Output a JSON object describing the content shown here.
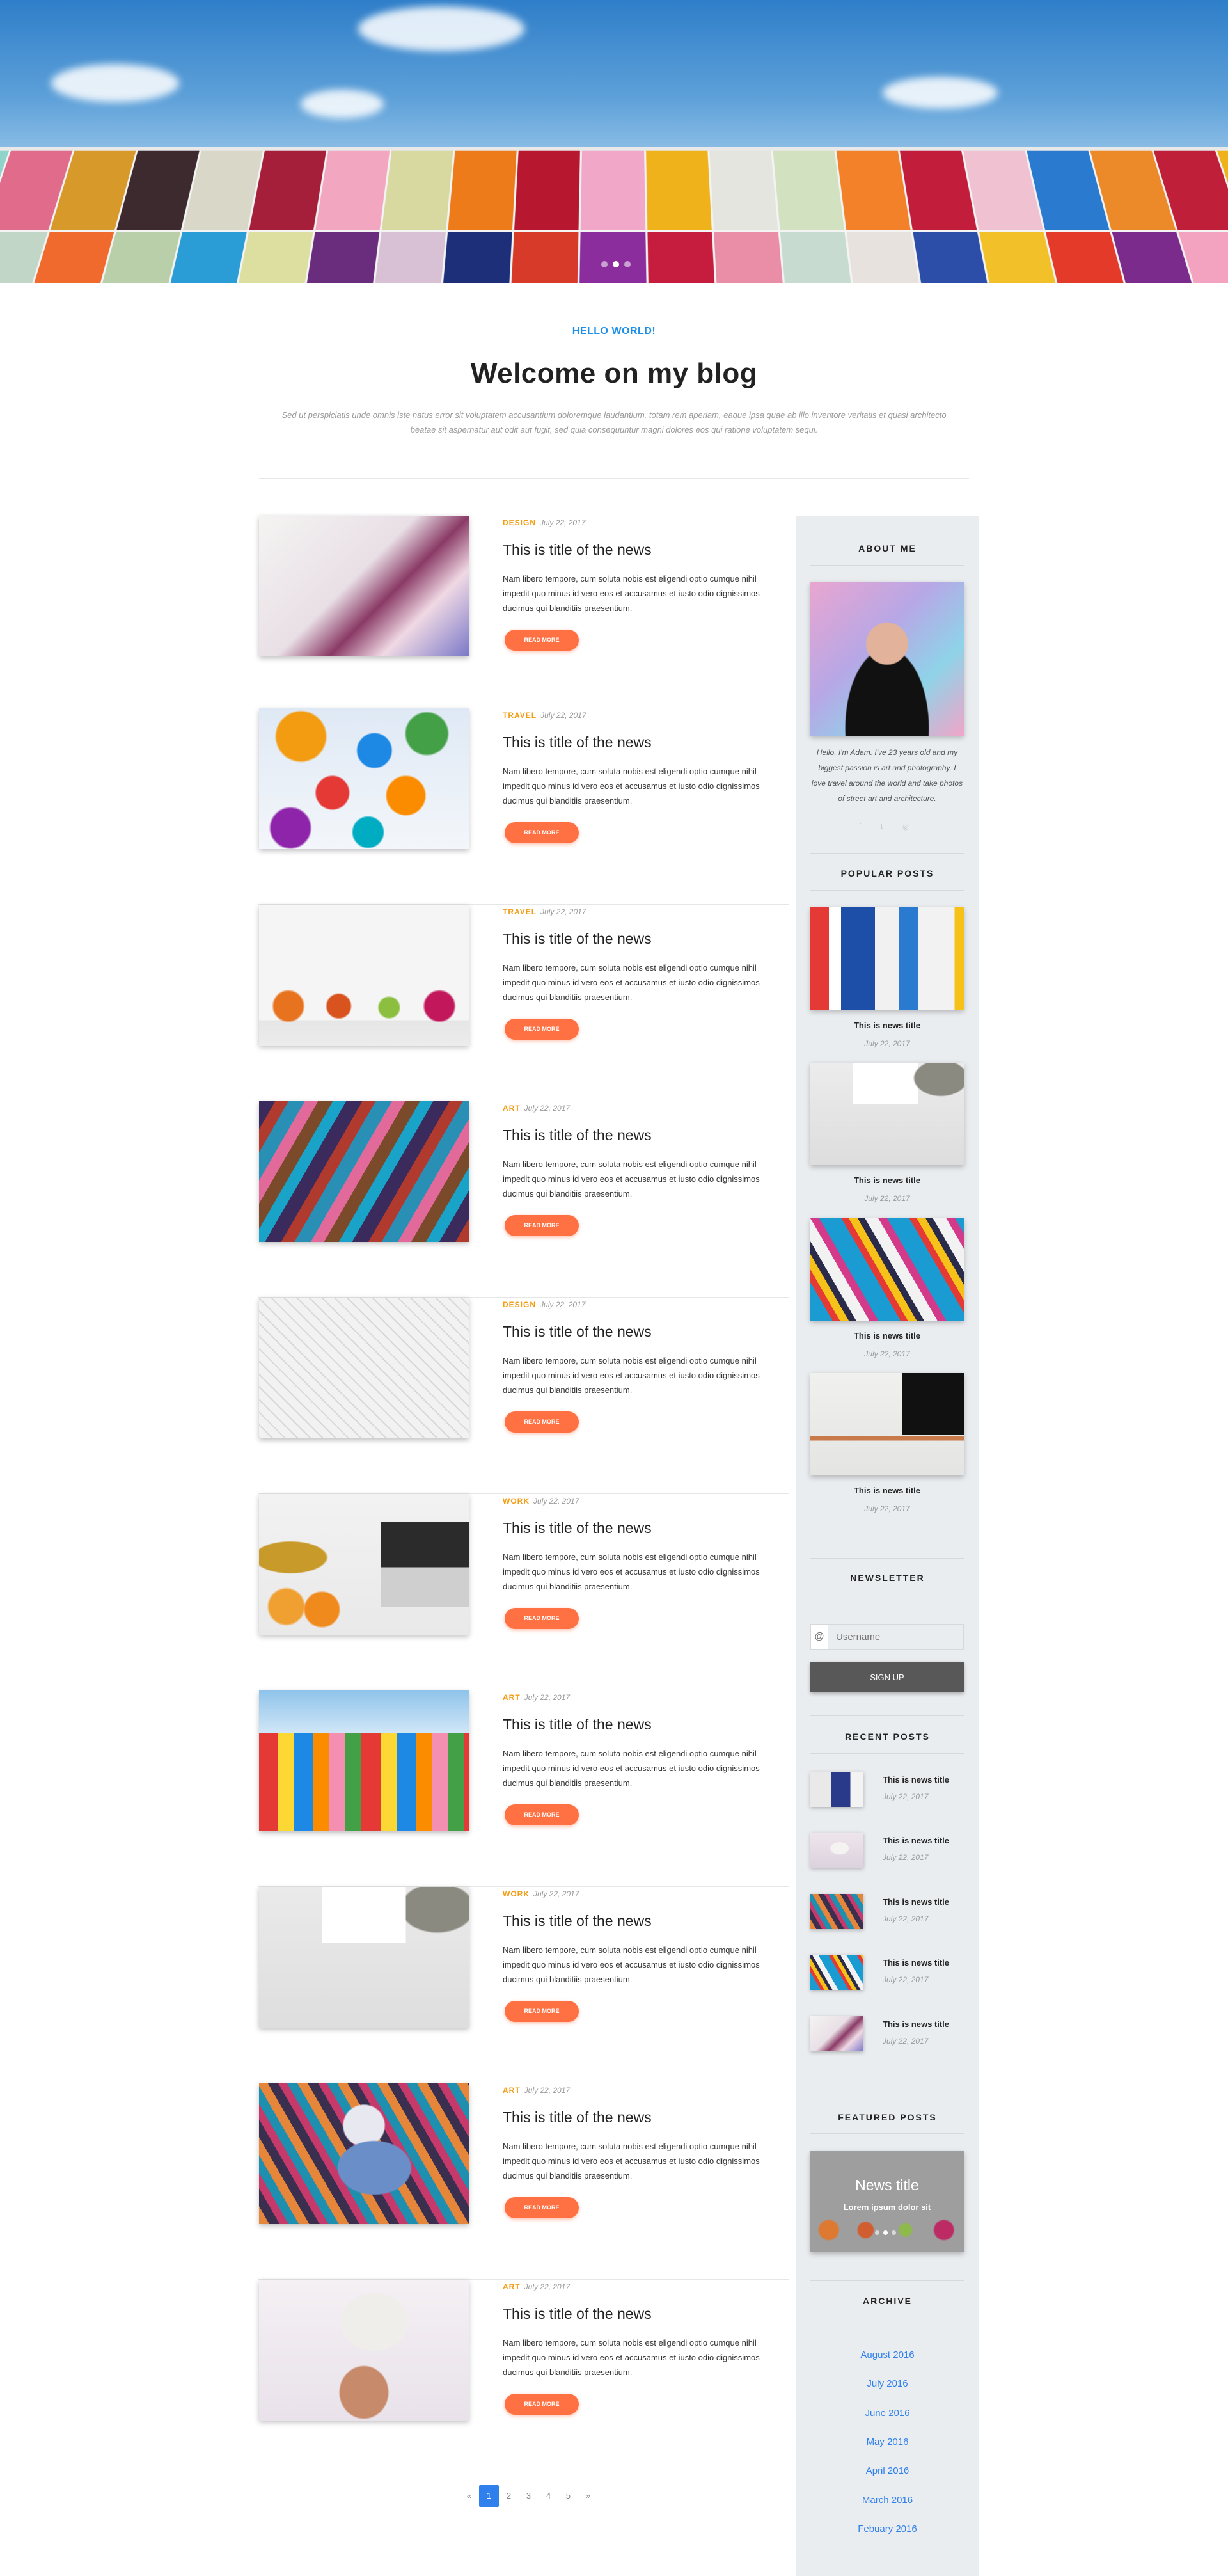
{
  "hero": {
    "slides": 3,
    "active_slide": 2
  },
  "intro": {
    "kicker": "HELLO WORLD!",
    "title": "Welcome on my blog",
    "text": "Sed ut perspiciatis unde omnis iste natus error sit voluptatem accusantium doloremque laudantium, totam rem aperiam, eaque ipsa quae ab illo inventore veritatis et quasi architecto beatae sit aspernatur aut odit aut fugit, sed quia consequuntur magni dolores eos qui ratione voluptatem sequi."
  },
  "posts": [
    {
      "category": "DESIGN",
      "date": "July 22, 2017",
      "title": "This is title of the news",
      "text": "Nam libero tempore, cum soluta nobis est eligendi optio cumque nihil impedit quo minus id vero eos et accusamus et iusto odio dignissimos ducimus qui blanditiis praesentium.",
      "button": "READ MORE"
    },
    {
      "category": "TRAVEL",
      "date": "July 22, 2017",
      "title": "This is title of the news",
      "text": "Nam libero tempore, cum soluta nobis est eligendi optio cumque nihil impedit quo minus id vero eos et accusamus et iusto odio dignissimos ducimus qui blanditiis praesentium.",
      "button": "READ MORE"
    },
    {
      "category": "TRAVEL",
      "date": "July 22, 2017",
      "title": "This is title of the news",
      "text": "Nam libero tempore, cum soluta nobis est eligendi optio cumque nihil impedit quo minus id vero eos et accusamus et iusto odio dignissimos ducimus qui blanditiis praesentium.",
      "button": "READ MORE"
    },
    {
      "category": "ART",
      "date": "July 22, 2017",
      "title": "This is title of the news",
      "text": "Nam libero tempore, cum soluta nobis est eligendi optio cumque nihil impedit quo minus id vero eos et accusamus et iusto odio dignissimos ducimus qui blanditiis praesentium.",
      "button": "READ MORE"
    },
    {
      "category": "DESIGN",
      "date": "July 22, 2017",
      "title": "This is title of the news",
      "text": "Nam libero tempore, cum soluta nobis est eligendi optio cumque nihil impedit quo minus id vero eos et accusamus et iusto odio dignissimos ducimus qui blanditiis praesentium.",
      "button": "READ MORE"
    },
    {
      "category": "WORK",
      "date": "July 22, 2017",
      "title": "This is title of the news",
      "text": "Nam libero tempore, cum soluta nobis est eligendi optio cumque nihil impedit quo minus id vero eos et accusamus et iusto odio dignissimos ducimus qui blanditiis praesentium.",
      "button": "READ MORE"
    },
    {
      "category": "ART",
      "date": "July 22, 2017",
      "title": "This is title of the news",
      "text": "Nam libero tempore, cum soluta nobis est eligendi optio cumque nihil impedit quo minus id vero eos et accusamus et iusto odio dignissimos ducimus qui blanditiis praesentium.",
      "button": "READ MORE"
    },
    {
      "category": "WORK",
      "date": "July 22, 2017",
      "title": "This is title of the news",
      "text": "Nam libero tempore, cum soluta nobis est eligendi optio cumque nihil impedit quo minus id vero eos et accusamus et iusto odio dignissimos ducimus qui blanditiis praesentium.",
      "button": "READ MORE"
    },
    {
      "category": "ART",
      "date": "July 22, 2017",
      "title": "This is title of the news",
      "text": "Nam libero tempore, cum soluta nobis est eligendi optio cumque nihil impedit quo minus id vero eos et accusamus et iusto odio dignissimos ducimus qui blanditiis praesentium.",
      "button": "READ MORE"
    },
    {
      "category": "ART",
      "date": "July 22, 2017",
      "title": "This is title of the news",
      "text": "Nam libero tempore, cum soluta nobis est eligendi optio cumque nihil impedit quo minus id vero eos et accusamus et iusto odio dignissimos ducimus qui blanditiis praesentium.",
      "button": "READ MORE"
    }
  ],
  "pagination": {
    "prev": "«",
    "pages": [
      "1",
      "2",
      "3",
      "4",
      "5"
    ],
    "active": "1",
    "next": "»"
  },
  "sidebar": {
    "about": {
      "title": "ABOUT ME",
      "text": "Hello, I'm Adam. I've 23 years old and my biggest passion is art and photography. I love travel around the world and take photos of street art and architecture."
    },
    "popular": {
      "title": "POPULAR POSTS",
      "items": [
        {
          "title": "This is news title",
          "date": "July 22, 2017"
        },
        {
          "title": "This is news title",
          "date": "July 22, 2017"
        },
        {
          "title": "This is news title",
          "date": "July 22, 2017"
        },
        {
          "title": "This is news title",
          "date": "July 22, 2017"
        }
      ]
    },
    "newsletter": {
      "title": "NEWSLETTER",
      "at": "@",
      "placeholder": "Username",
      "button": "SIGN UP"
    },
    "recent": {
      "title": "RECENT POSTS",
      "items": [
        {
          "title": "This is news title",
          "date": "July 22, 2017"
        },
        {
          "title": "This is news title",
          "date": "July 22, 2017"
        },
        {
          "title": "This is news title",
          "date": "July 22, 2017"
        },
        {
          "title": "This is news title",
          "date": "July 22, 2017"
        },
        {
          "title": "This is news title",
          "date": "July 22, 2017"
        }
      ]
    },
    "featured": {
      "title": "FEATURED POSTS",
      "slide_title": "News title",
      "slide_text": "Lorem ipsum dolor sit"
    },
    "archive": {
      "title": "ARCHIVE",
      "items": [
        "August 2016",
        "July 2016",
        "June 2016",
        "May 2016",
        "April 2016",
        "March 2016",
        "Febuary 2016"
      ]
    }
  },
  "colors": {
    "accent_blue": "#1d8fe8",
    "category_orange": "#f39c12",
    "button_orange": "#ff7043",
    "sidebar_bg": "#eaedf0",
    "link_blue": "#2f80ed"
  }
}
